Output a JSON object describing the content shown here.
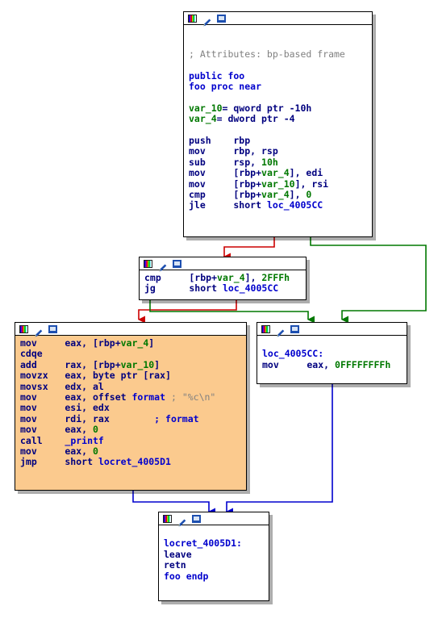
{
  "graph": {
    "title": "IDA Pro control flow graph of function foo",
    "colors": {
      "edge_false": "#cc0000",
      "edge_true": "#007800",
      "edge_normal": "#0000cd",
      "node_highlight": "#fbca8e",
      "node_background": "#ffffff",
      "node_border": "#000000",
      "keyword": "#00007f",
      "name": "#0000cd",
      "number": "#007800",
      "comment": "#808080"
    },
    "node_icons": [
      "palette-icon",
      "pencil-icon",
      "screen-icon"
    ]
  },
  "nodes": [
    {
      "id": "entry",
      "name": "node-entry-foo",
      "highlighted": false,
      "lines": [
        {
          "blank": true
        },
        {
          "blank": true
        },
        {
          "tokens": [
            {
              "t": "; Attributes: bp-based frame",
              "c": "c-gry"
            }
          ]
        },
        {
          "blank": true
        },
        {
          "tokens": [
            {
              "t": "public foo",
              "c": "c-blue"
            }
          ]
        },
        {
          "tokens": [
            {
              "t": "foo proc near",
              "c": "c-blue"
            }
          ]
        },
        {
          "blank": true
        },
        {
          "tokens": [
            {
              "t": "var_10",
              "c": "c-grn"
            },
            {
              "t": "= qword ptr -10h",
              "c": "c-kw"
            }
          ]
        },
        {
          "tokens": [
            {
              "t": "var_4",
              "c": "c-grn"
            },
            {
              "t": "= dword ptr -4",
              "c": "c-kw"
            }
          ]
        },
        {
          "blank": true
        },
        {
          "tokens": [
            {
              "t": "push    rbp",
              "c": "c-kw"
            }
          ]
        },
        {
          "tokens": [
            {
              "t": "mov     rbp, rsp",
              "c": "c-kw"
            }
          ]
        },
        {
          "tokens": [
            {
              "t": "sub     rsp, ",
              "c": "c-kw"
            },
            {
              "t": "10h",
              "c": "c-grn"
            }
          ]
        },
        {
          "tokens": [
            {
              "t": "mov     [rbp+",
              "c": "c-kw"
            },
            {
              "t": "var_4",
              "c": "c-grn"
            },
            {
              "t": "], edi",
              "c": "c-kw"
            }
          ]
        },
        {
          "tokens": [
            {
              "t": "mov     [rbp+",
              "c": "c-kw"
            },
            {
              "t": "var_10",
              "c": "c-grn"
            },
            {
              "t": "], rsi",
              "c": "c-kw"
            }
          ]
        },
        {
          "tokens": [
            {
              "t": "cmp     [rbp+",
              "c": "c-kw"
            },
            {
              "t": "var_4",
              "c": "c-grn"
            },
            {
              "t": "], ",
              "c": "c-kw"
            },
            {
              "t": "0",
              "c": "c-grn"
            }
          ]
        },
        {
          "tokens": [
            {
              "t": "jle     short ",
              "c": "c-kw"
            },
            {
              "t": "loc_4005CC",
              "c": "c-blue"
            }
          ]
        }
      ]
    },
    {
      "id": "cmp2fffh",
      "name": "node-cmp-2fffh",
      "highlighted": false,
      "lines": [
        {
          "tokens": [
            {
              "t": "cmp     [rbp+",
              "c": "c-kw"
            },
            {
              "t": "var_4",
              "c": "c-grn"
            },
            {
              "t": "], ",
              "c": "c-kw"
            },
            {
              "t": "2FFFh",
              "c": "c-grn"
            }
          ]
        },
        {
          "tokens": [
            {
              "t": "jg      short ",
              "c": "c-kw"
            },
            {
              "t": "loc_4005CC",
              "c": "c-blue"
            }
          ]
        }
      ]
    },
    {
      "id": "printf",
      "name": "node-printf-body",
      "highlighted": true,
      "lines": [
        {
          "tokens": [
            {
              "t": "mov     eax, [rbp+",
              "c": "c-kw"
            },
            {
              "t": "var_4",
              "c": "c-grn"
            },
            {
              "t": "]",
              "c": "c-kw"
            }
          ]
        },
        {
          "tokens": [
            {
              "t": "cdqe",
              "c": "c-kw"
            }
          ]
        },
        {
          "tokens": [
            {
              "t": "add     rax, [rbp+",
              "c": "c-kw"
            },
            {
              "t": "var_10",
              "c": "c-grn"
            },
            {
              "t": "]",
              "c": "c-kw"
            }
          ]
        },
        {
          "tokens": [
            {
              "t": "movzx   eax, byte ptr [rax]",
              "c": "c-kw"
            }
          ]
        },
        {
          "tokens": [
            {
              "t": "movsx   edx, al",
              "c": "c-kw"
            }
          ]
        },
        {
          "tokens": [
            {
              "t": "mov     eax, offset ",
              "c": "c-kw"
            },
            {
              "t": "format",
              "c": "c-blue"
            },
            {
              "t": " ; ",
              "c": "c-str"
            },
            {
              "t": "\"%c\\n\"",
              "c": "c-str"
            }
          ]
        },
        {
          "tokens": [
            {
              "t": "mov     esi, edx",
              "c": "c-kw"
            }
          ]
        },
        {
          "tokens": [
            {
              "t": "mov     rdi, rax        ",
              "c": "c-kw"
            },
            {
              "t": "; format",
              "c": "c-cmt"
            }
          ]
        },
        {
          "tokens": [
            {
              "t": "mov     eax, ",
              "c": "c-kw"
            },
            {
              "t": "0",
              "c": "c-grn"
            }
          ]
        },
        {
          "tokens": [
            {
              "t": "call    ",
              "c": "c-kw"
            },
            {
              "t": "_printf",
              "c": "c-blue"
            }
          ]
        },
        {
          "tokens": [
            {
              "t": "mov     eax, ",
              "c": "c-kw"
            },
            {
              "t": "0",
              "c": "c-grn"
            }
          ]
        },
        {
          "tokens": [
            {
              "t": "jmp     short ",
              "c": "c-kw"
            },
            {
              "t": "locret_4005D1",
              "c": "c-blue"
            }
          ]
        }
      ]
    },
    {
      "id": "loc4005cc",
      "name": "node-loc-4005cc",
      "highlighted": false,
      "lines": [
        {
          "blank": true
        },
        {
          "tokens": [
            {
              "t": "loc_4005CC:",
              "c": "c-blue"
            }
          ]
        },
        {
          "tokens": [
            {
              "t": "mov     eax, ",
              "c": "c-kw"
            },
            {
              "t": "0FFFFFFFFh",
              "c": "c-grn"
            }
          ]
        }
      ]
    },
    {
      "id": "locret",
      "name": "node-locret-4005d1",
      "highlighted": false,
      "lines": [
        {
          "blank": true
        },
        {
          "tokens": [
            {
              "t": "locret_4005D1:",
              "c": "c-blue"
            }
          ]
        },
        {
          "tokens": [
            {
              "t": "leave",
              "c": "c-kw"
            }
          ]
        },
        {
          "tokens": [
            {
              "t": "retn",
              "c": "c-kw"
            }
          ]
        },
        {
          "tokens": [
            {
              "t": "foo endp",
              "c": "c-blue"
            }
          ]
        }
      ]
    }
  ],
  "edges": [
    {
      "name": "edge-entry-false-to-cmp",
      "from": "entry",
      "to": "cmp2fffh",
      "kind": "false"
    },
    {
      "name": "edge-entry-true-to-loc",
      "from": "entry",
      "to": "loc4005cc",
      "kind": "true"
    },
    {
      "name": "edge-cmp-false-to-printf",
      "from": "cmp2fffh",
      "to": "printf",
      "kind": "false"
    },
    {
      "name": "edge-cmp-true-to-loc",
      "from": "cmp2fffh",
      "to": "loc4005cc",
      "kind": "true"
    },
    {
      "name": "edge-printf-to-locret",
      "from": "printf",
      "to": "locret",
      "kind": "normal"
    },
    {
      "name": "edge-loc-to-locret",
      "from": "loc4005cc",
      "to": "locret",
      "kind": "normal"
    }
  ]
}
